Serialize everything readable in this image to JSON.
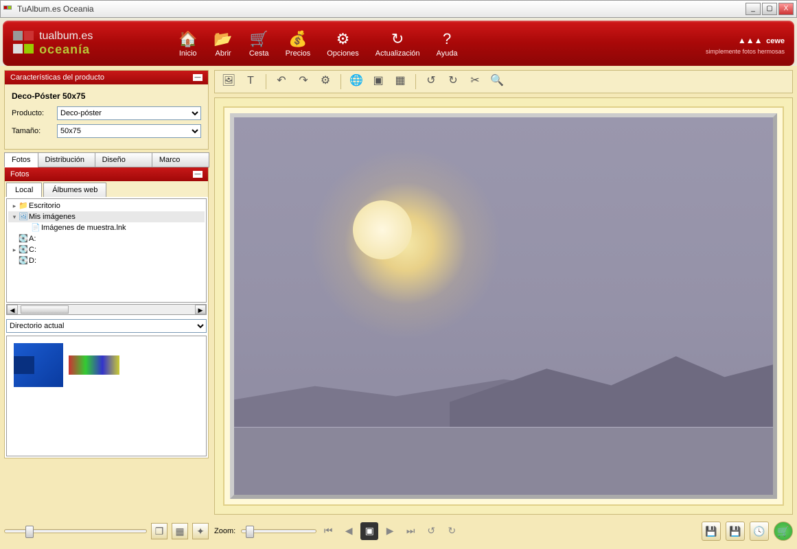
{
  "window": {
    "title": "TuAlbum.es Oceania"
  },
  "brand": {
    "line1": "tualbum.es",
    "line2": "oceanía",
    "partner": "cewe",
    "tagline": "simplemente fotos hermosas"
  },
  "toolbar": [
    {
      "label": "Inicio",
      "icon": "🏠"
    },
    {
      "label": "Abrir",
      "icon": "📂"
    },
    {
      "label": "Cesta",
      "icon": "🛒"
    },
    {
      "label": "Precios",
      "icon": "💰"
    },
    {
      "label": "Opciones",
      "icon": "⚙"
    },
    {
      "label": "Actualización",
      "icon": "↻"
    },
    {
      "label": "Ayuda",
      "icon": "?"
    }
  ],
  "product_panel": {
    "header": "Características del producto",
    "title": "Deco-Póster 50x75",
    "product_label": "Producto:",
    "product_value": "Deco-póster",
    "size_label": "Tamaño:",
    "size_value": "50x75"
  },
  "mid_tabs": [
    "Fotos",
    "Distribución",
    "Diseño",
    "Marco"
  ],
  "photos_panel": {
    "header": "Fotos",
    "source_tabs": [
      "Local",
      "Álbumes web"
    ],
    "tree": [
      {
        "label": "Escritorio",
        "indent": 0,
        "exp": "▸",
        "icon": "folder"
      },
      {
        "label": "Mis imágenes",
        "indent": 0,
        "exp": "▾",
        "icon": "pic",
        "sel": true
      },
      {
        "label": "Imágenes de muestra.lnk",
        "indent": 1,
        "exp": "",
        "icon": "link"
      },
      {
        "label": "A:",
        "indent": 0,
        "exp": "",
        "icon": "drive"
      },
      {
        "label": "C:",
        "indent": 0,
        "exp": "▸",
        "icon": "drive"
      },
      {
        "label": "D:",
        "indent": 0,
        "exp": "",
        "icon": "drive"
      }
    ],
    "dir_select": "Directorio actual"
  },
  "zoom_label": "Zoom:",
  "icons": {
    "folder": "📁",
    "pic": "🖼",
    "drive": "💽",
    "link": "📄"
  }
}
